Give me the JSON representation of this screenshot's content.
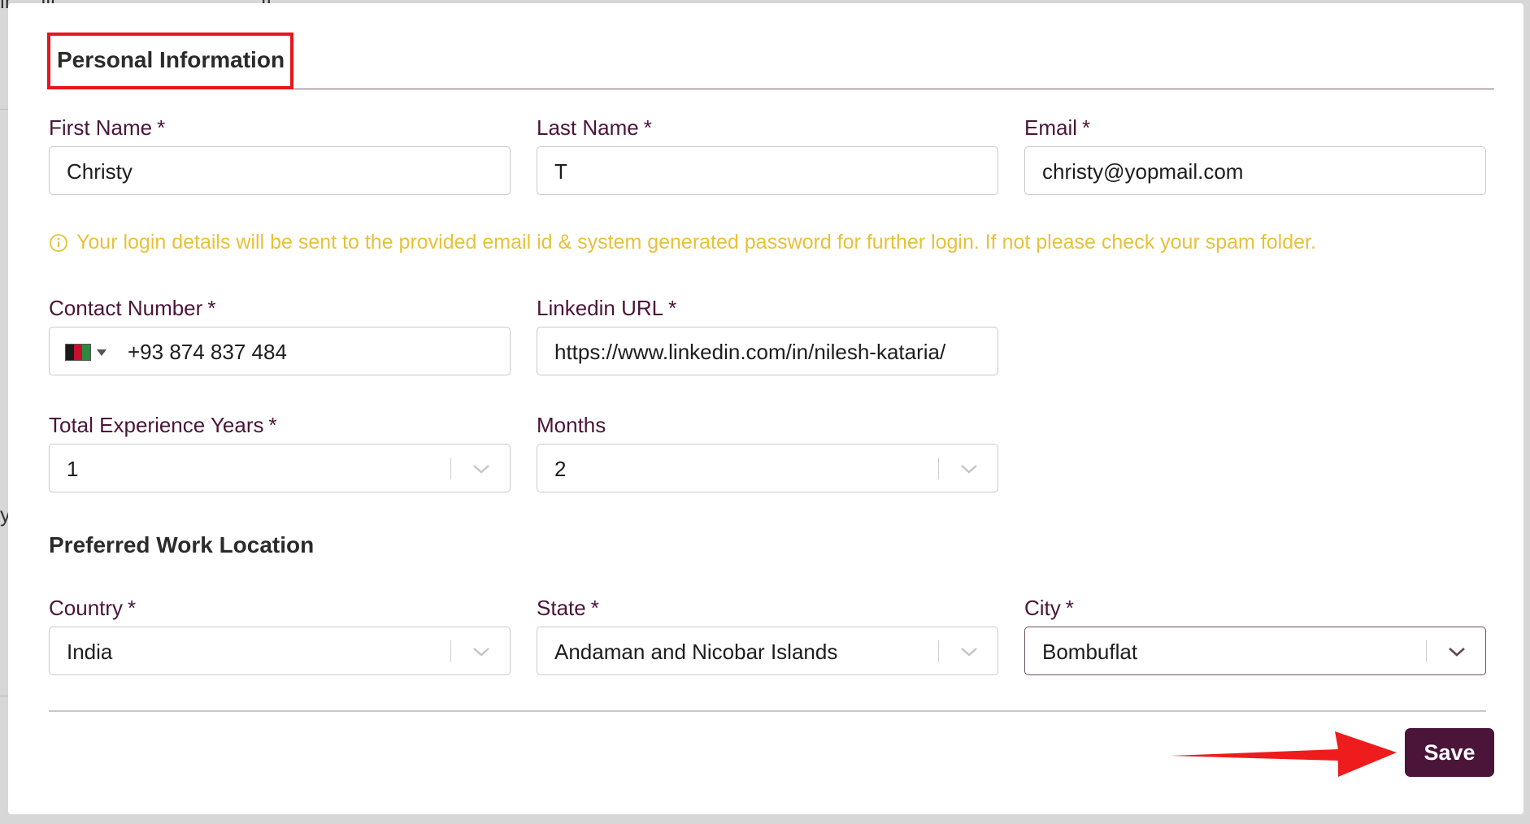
{
  "section": {
    "title": "Personal Information"
  },
  "fields": {
    "first_name": {
      "label": "First Name",
      "required": "*",
      "value": "Christy"
    },
    "last_name": {
      "label": "Last Name",
      "required": "*",
      "value": "T"
    },
    "email": {
      "label": "Email",
      "required": "*",
      "value": "christy@yopmail.com"
    },
    "contact": {
      "label": "Contact Number",
      "required": "*",
      "value": "+93 874 837 484",
      "country_flag": "afghanistan-flag"
    },
    "linkedin": {
      "label": "Linkedin URL",
      "required": "*",
      "value": "https://www.linkedin.com/in/nilesh-kataria/"
    },
    "exp_years": {
      "label": "Total Experience Years",
      "required": "*",
      "value": "1"
    },
    "exp_months": {
      "label": "Months",
      "value": "2"
    },
    "country": {
      "label": "Country",
      "required": "*",
      "value": "India"
    },
    "state": {
      "label": "State",
      "required": "*",
      "value": "Andaman and Nicobar Islands"
    },
    "city": {
      "label": "City",
      "required": "*",
      "value": "Bombuflat"
    }
  },
  "info_message": "Your login details will be sent to the provided email id & system generated password for further login. If not please check your spam folder.",
  "subheading": "Preferred Work Location",
  "save_label": "Save",
  "colors": {
    "brand": "#4a1539",
    "info": "#e8c13a",
    "highlight": "#e8141c"
  }
}
